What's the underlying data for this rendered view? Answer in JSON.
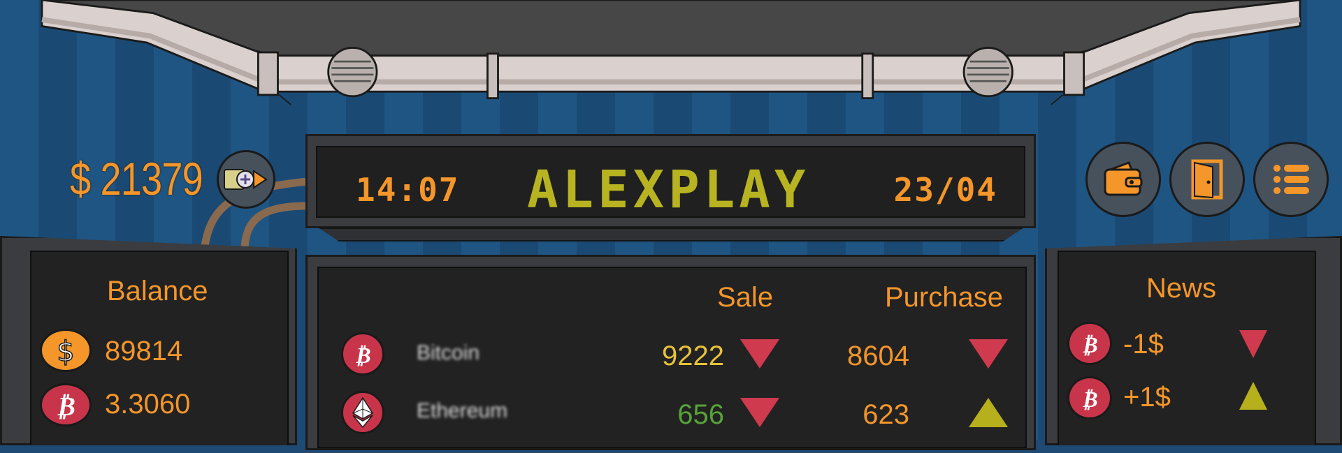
{
  "header": {
    "time": "14:07",
    "title": "ALEXPLAY",
    "date": "23/04"
  },
  "money": {
    "label": "$ 21379",
    "exchange_icon": "cash-exchange-icon"
  },
  "top_right_buttons": [
    {
      "name": "wallet-button",
      "icon": "wallet-icon"
    },
    {
      "name": "exit-door-button",
      "icon": "door-icon"
    },
    {
      "name": "menu-button",
      "icon": "list-icon"
    }
  ],
  "balance": {
    "title": "Balance",
    "items": [
      {
        "icon": "dollar-coin-icon",
        "value": "89814"
      },
      {
        "icon": "bitcoin-icon",
        "value": "3.3060"
      }
    ]
  },
  "market": {
    "sale_header": "Sale",
    "purchase_header": "Purchase",
    "rows": [
      {
        "icon": "bitcoin-icon",
        "name": "Bitcoin",
        "sale": "9222",
        "sale_trend": "down",
        "purchase": "8604",
        "purchase_trend": "down"
      },
      {
        "icon": "ethereum-icon",
        "name": "Ethereum",
        "sale": "656",
        "sale_trend": "down",
        "purchase": "623",
        "purchase_trend": "up"
      }
    ]
  },
  "news": {
    "title": "News",
    "items": [
      {
        "icon": "bitcoin-icon",
        "text": "-1$",
        "trend": "down"
      },
      {
        "icon": "bitcoin-icon",
        "text": "+1$",
        "trend": "up"
      }
    ]
  },
  "colors": {
    "accent": "#f4962a",
    "title_text": "#b8b321",
    "down": "#d03a4e",
    "up": "#b5b01c",
    "sale_value": "#e8c23a",
    "sale_value_alt": "#57a33a"
  }
}
